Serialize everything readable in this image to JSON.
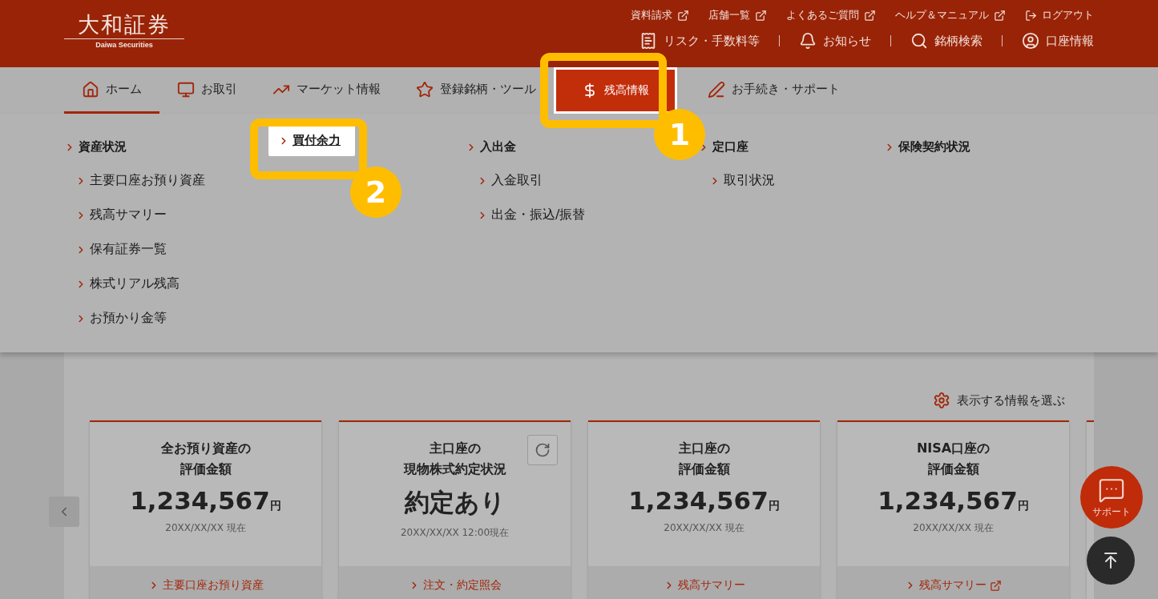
{
  "header": {
    "logo": "大和証券",
    "logo_sub": "Daiwa Securities",
    "top_links": [
      {
        "label": "資料請求",
        "kind": "external"
      },
      {
        "label": "店舗一覧",
        "kind": "external"
      },
      {
        "label": "よくあるご質問",
        "kind": "external"
      },
      {
        "label": "ヘルプ＆マニュアル",
        "kind": "external"
      },
      {
        "label": "ログアウト",
        "kind": "logout"
      }
    ],
    "utility_links": [
      {
        "label": "リスク・手数料等"
      },
      {
        "label": "お知らせ"
      },
      {
        "label": "銘柄検索"
      },
      {
        "label": "口座情報"
      }
    ]
  },
  "nav": {
    "tabs": [
      {
        "label": "ホーム",
        "selected": true,
        "expanded": false
      },
      {
        "label": "お取引",
        "selected": false,
        "expanded": false
      },
      {
        "label": "マーケット情報",
        "selected": false,
        "expanded": false
      },
      {
        "label": "登録銘柄・ツール",
        "selected": false,
        "expanded": false
      },
      {
        "label": "残高情報",
        "selected": false,
        "expanded": true
      },
      {
        "label": "お手続き・サポート",
        "selected": false,
        "expanded": false
      }
    ]
  },
  "menu": {
    "columns": [
      {
        "groups": [
          {
            "label": "資産状況",
            "highlighted": false,
            "children": [
              {
                "label": "主要口座お預り資産"
              },
              {
                "label": "残高サマリー"
              },
              {
                "label": "保有証券一覧"
              },
              {
                "label": "株式リアル残高"
              },
              {
                "label": "お預かり金等"
              }
            ]
          }
        ]
      },
      {
        "groups": [
          {
            "label": "買付余力",
            "highlighted": true
          }
        ]
      },
      {
        "groups": [
          {
            "label": "入出金",
            "highlighted": false,
            "children": [
              {
                "label": "入金取引"
              },
              {
                "label": "出金・振込/振替"
              }
            ]
          }
        ]
      },
      {
        "groups": [
          {
            "label": "定口座",
            "highlighted": false,
            "children": [
              {
                "label": "取引状況"
              }
            ]
          }
        ]
      },
      {
        "groups": [
          {
            "label": "保険契約状況",
            "highlighted": false
          }
        ]
      }
    ]
  },
  "callouts": [
    {
      "number": "1"
    },
    {
      "number": "2"
    }
  ],
  "overview": {
    "settings": "表示する情報を選ぶ",
    "cards": [
      {
        "title": [
          "全お預り資産の",
          "評価金額"
        ],
        "value": "1,234,567",
        "unit": "円",
        "date": "20XX/XX/XX 現在",
        "link": "主要口座お預り資産",
        "refresh": false,
        "external": false
      },
      {
        "title": [
          "主口座の",
          "現物株式約定状況"
        ],
        "value": "約定あり",
        "date": "20XX/XX/XX 12:00現在",
        "link": "注文・約定照会",
        "refresh": true,
        "external": false
      },
      {
        "title": [
          "主口座の",
          "評価金額"
        ],
        "value": "1,234,567",
        "unit": "円",
        "date": "20XX/XX/XX 現在",
        "link": "残高サマリー",
        "refresh": false,
        "external": false
      },
      {
        "title": [
          "NISA口座の",
          "評価金額"
        ],
        "value": "1,234,567",
        "unit": "円",
        "date": "20XX/XX/XX 現在",
        "link": "残高サマリー",
        "refresh": false,
        "external": true
      }
    ]
  },
  "support": {
    "label": "サポート"
  }
}
